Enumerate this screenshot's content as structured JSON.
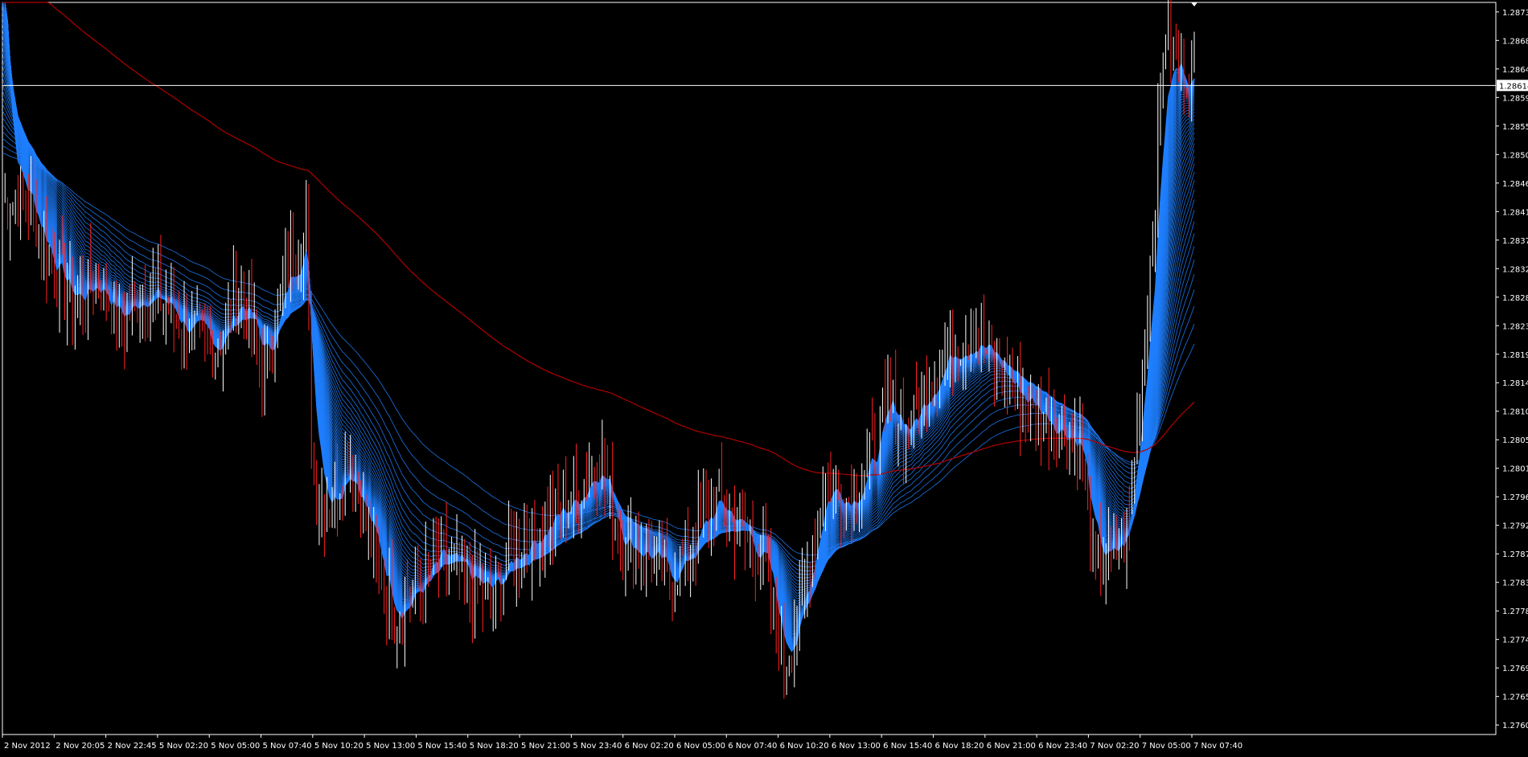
{
  "chart_data": {
    "type": "candlestick",
    "symbol_pair": "EURUSD-style price chart with fan of moving averages",
    "y_axis": {
      "ticks": [
        "1.28730",
        "1.28685",
        "1.28640",
        "1.28595",
        "1.28550",
        "1.28505",
        "1.28460",
        "1.28415",
        "1.28370",
        "1.28325",
        "1.28280",
        "1.28235",
        "1.28190",
        "1.28145",
        "1.28100",
        "1.28055",
        "1.28010",
        "1.27965",
        "1.27920",
        "1.27875",
        "1.27830",
        "1.27785",
        "1.27740",
        "1.27695",
        "1.27650",
        "1.27605"
      ],
      "range": [
        1.2759,
        1.28745
      ]
    },
    "current_price": "1.28614",
    "x_axis": {
      "ticks": [
        "2 Nov 2012",
        "2 Nov 20:05",
        "2 Nov 22:45",
        "5 Nov 02:20",
        "5 Nov 05:00",
        "5 Nov 07:40",
        "5 Nov 10:20",
        "5 Nov 13:00",
        "5 Nov 15:40",
        "5 Nov 18:20",
        "5 Nov 21:00",
        "5 Nov 23:40",
        "6 Nov 02:20",
        "6 Nov 05:00",
        "6 Nov 07:40",
        "6 Nov 10:20",
        "6 Nov 13:00",
        "6 Nov 15:40",
        "6 Nov 18:20",
        "6 Nov 21:00",
        "6 Nov 23:40",
        "7 Nov 02:20",
        "7 Nov 05:00",
        "7 Nov 07:40"
      ]
    },
    "price_path": [
      [
        0,
        1.2843
      ],
      [
        0.02,
        1.2844
      ],
      [
        0.04,
        1.2834
      ],
      [
        0.06,
        1.2827
      ],
      [
        0.08,
        1.2831
      ],
      [
        0.1,
        1.2824
      ],
      [
        0.12,
        1.283
      ],
      [
        0.14,
        1.2826
      ],
      [
        0.16,
        1.2822
      ],
      [
        0.18,
        1.282
      ],
      [
        0.2,
        1.2829
      ],
      [
        0.22,
        1.2817
      ],
      [
        0.24,
        1.2833
      ],
      [
        0.255,
        1.2838
      ],
      [
        0.26,
        1.28
      ],
      [
        0.275,
        1.2794
      ],
      [
        0.29,
        1.2804
      ],
      [
        0.31,
        1.2789
      ],
      [
        0.33,
        1.2778
      ],
      [
        0.35,
        1.2783
      ],
      [
        0.37,
        1.2787
      ],
      [
        0.39,
        1.2783
      ],
      [
        0.41,
        1.2781
      ],
      [
        0.43,
        1.2788
      ],
      [
        0.46,
        1.2793
      ],
      [
        0.48,
        1.2796
      ],
      [
        0.5,
        1.2803
      ],
      [
        0.52,
        1.2789
      ],
      [
        0.54,
        1.2788
      ],
      [
        0.56,
        1.2783
      ],
      [
        0.58,
        1.279
      ],
      [
        0.6,
        1.2796
      ],
      [
        0.62,
        1.2791
      ],
      [
        0.64,
        1.2786
      ],
      [
        0.655,
        1.277
      ],
      [
        0.67,
        1.2779
      ],
      [
        0.69,
        1.28
      ],
      [
        0.71,
        1.2796
      ],
      [
        0.73,
        1.2803
      ],
      [
        0.745,
        1.2812
      ],
      [
        0.76,
        1.2806
      ],
      [
        0.78,
        1.2816
      ],
      [
        0.8,
        1.2821
      ],
      [
        0.815,
        1.2822
      ],
      [
        0.83,
        1.2818
      ],
      [
        0.85,
        1.2813
      ],
      [
        0.87,
        1.281
      ],
      [
        0.89,
        1.2807
      ],
      [
        0.905,
        1.2805
      ],
      [
        0.915,
        1.2786
      ],
      [
        0.93,
        1.2786
      ],
      [
        0.945,
        1.2792
      ],
      [
        0.955,
        1.2815
      ],
      [
        0.965,
        1.2838
      ],
      [
        0.975,
        1.287
      ],
      [
        0.985,
        1.2865
      ],
      [
        1.0,
        1.2861
      ]
    ],
    "ma_fan": {
      "line_color": "#1f7fff",
      "line_count": 60
    },
    "long_ma": {
      "color": "#b00000"
    },
    "colors": {
      "background": "#000000",
      "bull": "#ffffff",
      "bear": "#ff2020",
      "axis": "#ffffff"
    }
  }
}
